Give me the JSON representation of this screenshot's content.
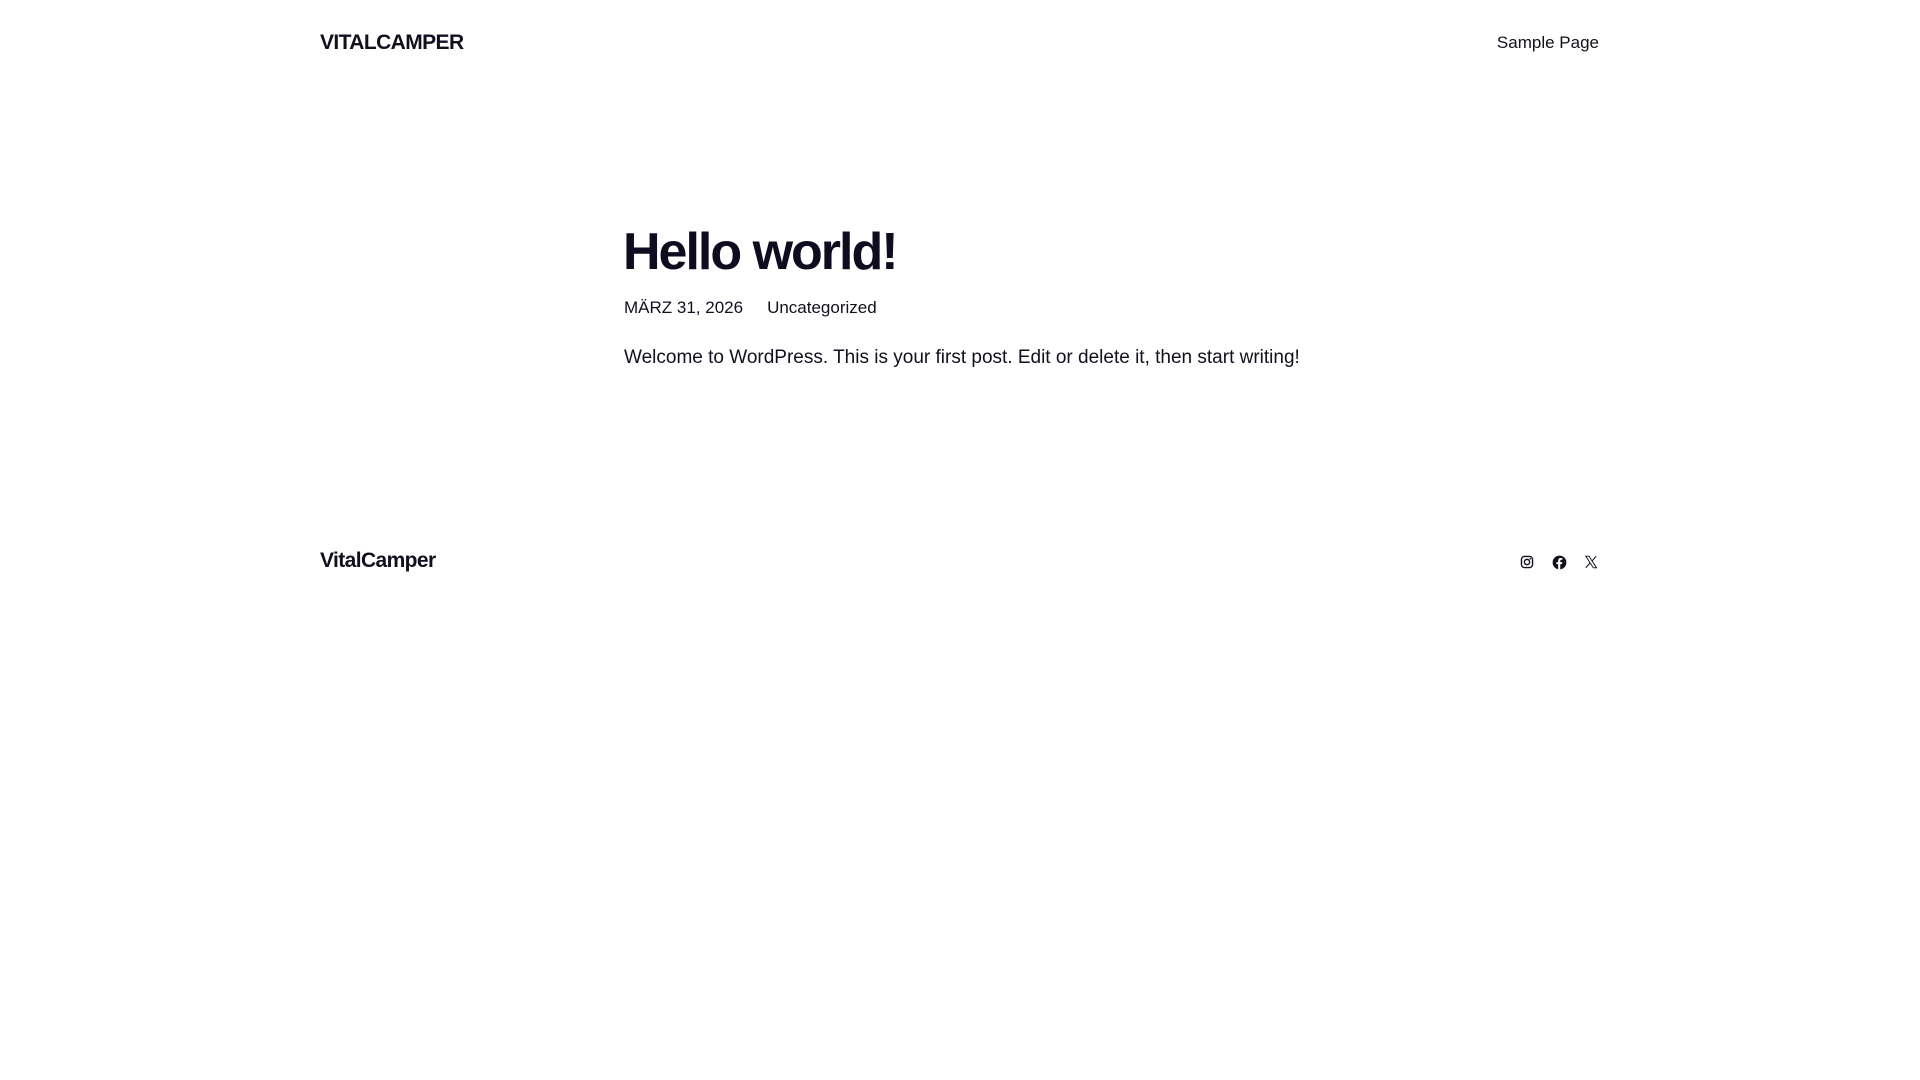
{
  "header": {
    "site_title": "VITALCAMPER",
    "nav": [
      {
        "label": "Sample Page"
      }
    ]
  },
  "post": {
    "title": "Hello world!",
    "date": "MÄRZ 31, 2026",
    "category": "Uncategorized",
    "content": "Welcome to WordPress. This is your first post. Edit or delete it, then start writing!"
  },
  "footer": {
    "site_title": "VitalCamper",
    "social": [
      {
        "icon": "instagram-icon"
      },
      {
        "icon": "facebook-icon"
      },
      {
        "icon": "x-icon"
      }
    ]
  },
  "colors": {
    "text": "#11101f",
    "background": "#ffffff"
  }
}
